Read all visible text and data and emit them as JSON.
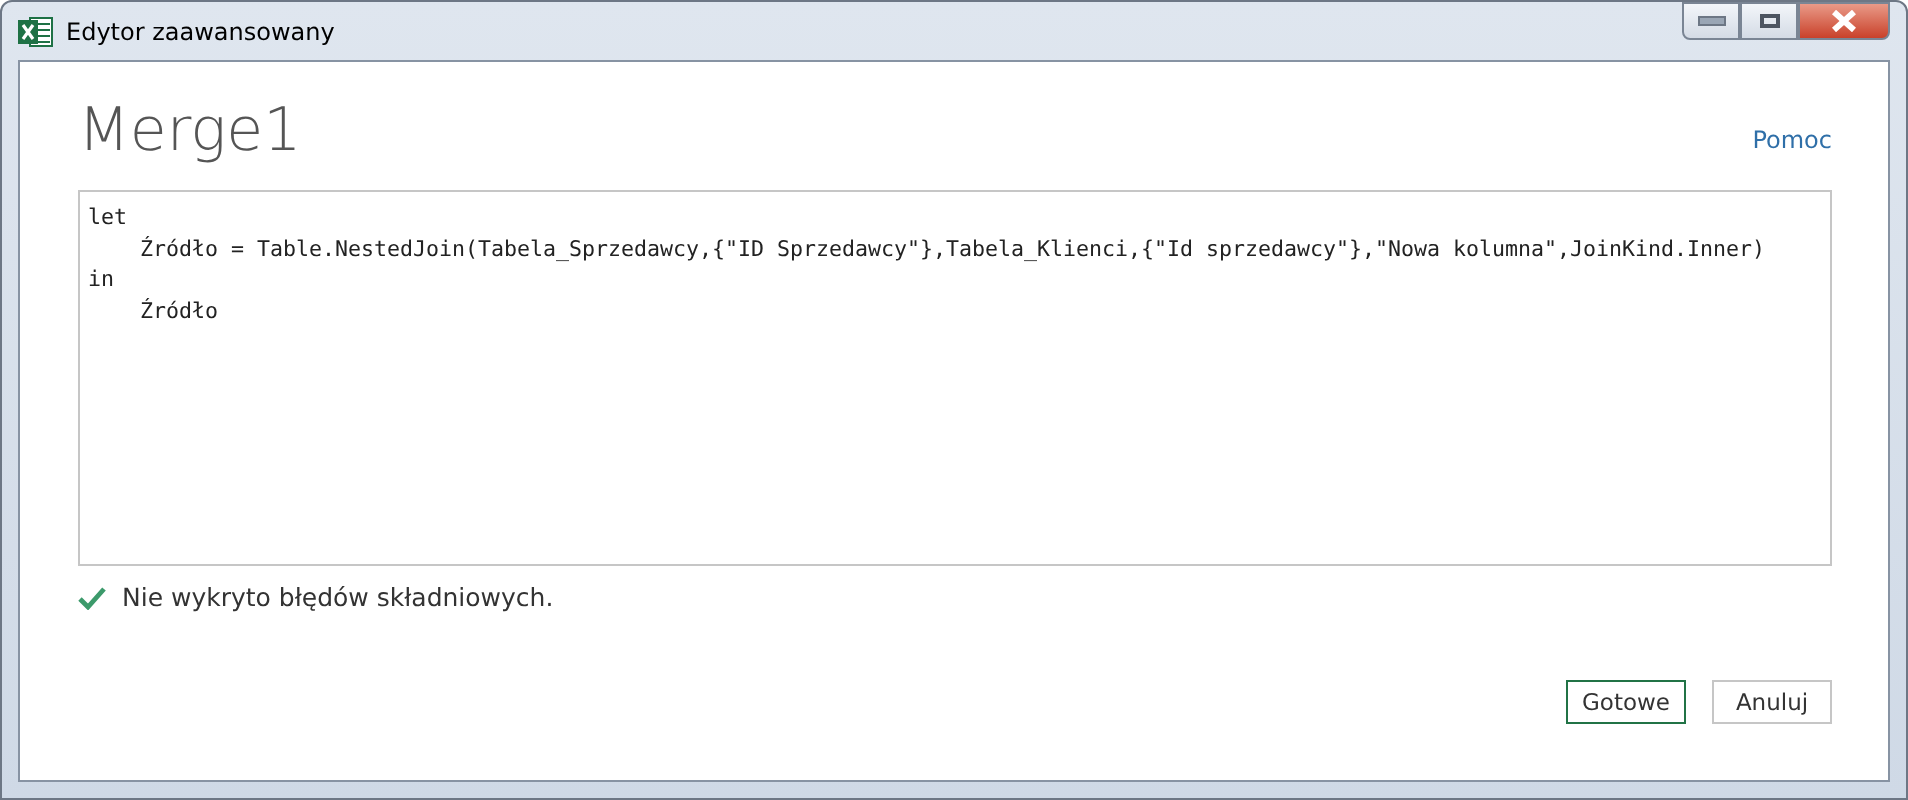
{
  "window": {
    "title": "Edytor zaawansowany"
  },
  "query_name": "Merge1",
  "help_link": "Pomoc",
  "code_lines": [
    "let",
    "    Źródło = Table.NestedJoin(Tabela_Sprzedawcy,{\"ID Sprzedawcy\"},Tabela_Klienci,{\"Id sprzedawcy\"},\"Nowa kolumna\",JoinKind.Inner)",
    "in",
    "    Źródło"
  ],
  "status": {
    "kind": "ok",
    "text": "Nie wykryto błędów składniowych."
  },
  "buttons": [
    {
      "label": "Gotowe",
      "default": true
    },
    {
      "label": "Anuluj",
      "default": false
    }
  ]
}
